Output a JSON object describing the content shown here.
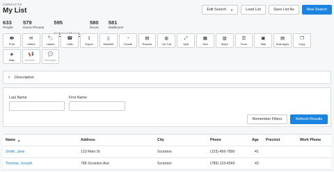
{
  "breadcrumb": "CONTACTS",
  "title": "My List",
  "header_buttons": {
    "edit_search": "Edit Search",
    "load_list": "Load List",
    "save_list_as": "Save List As",
    "new_search": "New Search"
  },
  "stats": [
    {
      "num": "633",
      "label": "People"
    },
    {
      "num": "579",
      "label": "Home Phones"
    },
    {
      "num": "595",
      "label": "Preferred Phones"
    },
    {
      "num": "580",
      "label": "Doors"
    },
    {
      "num": "581",
      "label": "Mailboxes"
    }
  ],
  "tools": [
    {
      "label": "Print",
      "icon": "print-icon",
      "glyph": "🖶"
    },
    {
      "label": "Letters",
      "icon": "envelope-icon",
      "glyph": "✉"
    },
    {
      "label": "Labels",
      "icon": "tag-icon",
      "glyph": "🏷"
    },
    {
      "label": "Calls",
      "icon": "phone-icon",
      "glyph": "☎"
    },
    {
      "label": "Export",
      "icon": "export-icon",
      "glyph": "⇪"
    },
    {
      "label": "MiniVAN",
      "icon": "mobile-icon",
      "glyph": "▯"
    },
    {
      "label": "Counts",
      "icon": "pie-chart-icon",
      "glyph": "◔"
    },
    {
      "label": "Reports",
      "icon": "report-icon",
      "glyph": "▤"
    },
    {
      "label": "Cut Turf",
      "icon": "globe-icon",
      "glyph": "◍"
    },
    {
      "label": "Split",
      "icon": "split-icon",
      "glyph": "⤢"
    },
    {
      "label": "Grid",
      "icon": "grid-icon",
      "glyph": "▦"
    },
    {
      "label": "Script",
      "icon": "script-icon",
      "glyph": "▥"
    },
    {
      "label": "Form",
      "icon": "form-icon",
      "glyph": "☰"
    },
    {
      "label": "Task",
      "icon": "task-icon",
      "glyph": "▣"
    },
    {
      "label": "Bulk Apply",
      "icon": "bulk-apply-icon",
      "glyph": "▤"
    },
    {
      "label": "Copy",
      "icon": "copy-icon",
      "glyph": "❐"
    },
    {
      "label": "Map",
      "icon": "map-icon",
      "glyph": "◈"
    },
    {
      "label": "Advertis...",
      "icon": "advertising-icon",
      "glyph": "📢",
      "disabled": true
    },
    {
      "label": "Messages",
      "icon": "messages-icon",
      "glyph": "💬",
      "disabled": true
    }
  ],
  "description": {
    "label": "Description"
  },
  "filters": {
    "last_name_label": "Last Name",
    "last_name_value": "",
    "first_name_label": "First Name",
    "first_name_value": "",
    "remember_filters": "Remember Filters",
    "refresh_results": "Refresh Results"
  },
  "table": {
    "columns": [
      "Name",
      "Address",
      "City",
      "Phone",
      "Age",
      "Precinct",
      "Work Phone"
    ],
    "rows": [
      [
        "Smith, Jane",
        "123 Main St",
        "Scranton",
        "(123) 456-7890",
        "41",
        "",
        ""
      ],
      [
        "Thomas, Joseph",
        "786 Scranton Ave",
        "Scranton",
        "(789) 123-4560",
        "43",
        "",
        ""
      ]
    ]
  }
}
